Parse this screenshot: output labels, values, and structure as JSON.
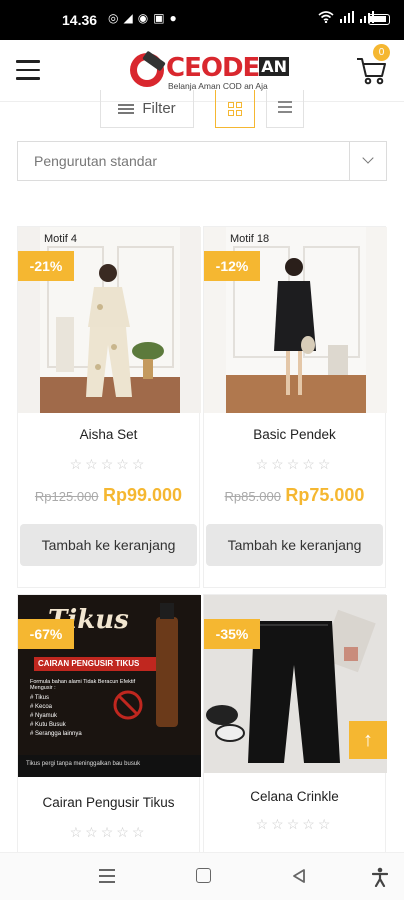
{
  "status_bar": {
    "time": "14.36",
    "icons": [
      "whatsapp-icon",
      "telegram-icon",
      "messenger-icon",
      "shopee-icon",
      "notification-icon"
    ]
  },
  "header": {
    "logo_name": "CEODE",
    "logo_suffix": "AN",
    "logo_tagline": "Belanja Aman COD an Aja",
    "cart_count": "0"
  },
  "toolbar": {
    "filter_label": "Filter",
    "sort_value": "Pengurutan standar"
  },
  "products": [
    {
      "name": "Aisha Set",
      "motif": "Motif 4",
      "sale": "-21%",
      "old_price": "Rp125.000",
      "price": "Rp99.000",
      "rating": 0,
      "button": "Tambah ke keranjang"
    },
    {
      "name": "Basic Pendek",
      "motif": "Motif 18",
      "sale": "-12%",
      "old_price": "Rp85.000",
      "price": "Rp75.000",
      "rating": 0,
      "button": "Tambah ke keranjang"
    },
    {
      "name": "Cairan Pengusir Tikus",
      "sale": "-67%",
      "rating": 0,
      "banner": {
        "title": "Tikus",
        "subtitle": "CAIRAN PENGUSIR TIKUS",
        "heading": "Formula bahan alami Tidak Beracun Efektif Mengusir :",
        "list": [
          "# Tikus",
          "# Kecoa",
          "# Nyamuk",
          "# Kutu Busuk",
          "# Serangga lainnya"
        ],
        "footer": "Tikus pergi tanpa meninggalkan bau busuk"
      }
    },
    {
      "name": "Celana Crinkle",
      "sale": "-35%",
      "rating": 0
    }
  ],
  "colors": {
    "accent": "#f5b731",
    "brand": "#d9272e"
  }
}
